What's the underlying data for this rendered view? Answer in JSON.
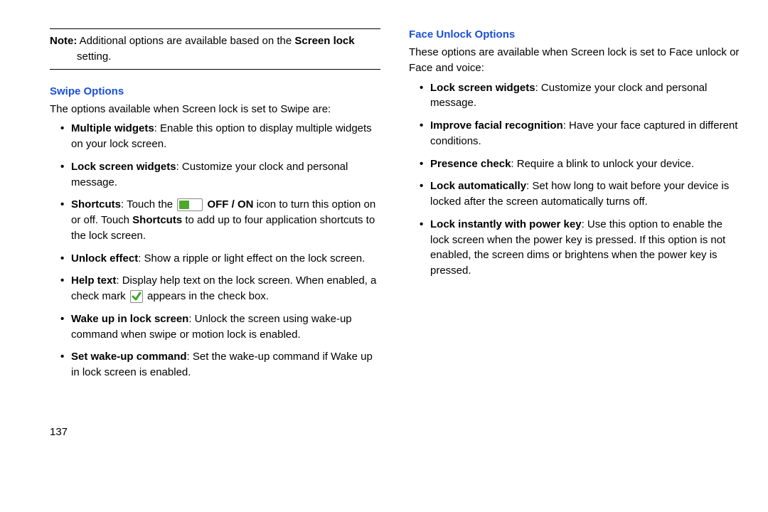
{
  "left": {
    "note_prefix": "Note:",
    "note_text1": " Additional options are available based on the ",
    "note_bold": "Screen lock",
    "note_text2": " setting.",
    "swipe_heading": "Swipe Options",
    "swipe_intro": "The options available when Screen lock is set to Swipe are:",
    "items": [
      {
        "bold": "Multiple widgets",
        "rest": ": Enable this option to display multiple widgets on your lock screen."
      },
      {
        "bold": "Lock screen widgets",
        "rest": ": Customize your clock and personal message."
      },
      {
        "bold": "Shortcuts",
        "pre": ": Touch the ",
        "icon": "toggle",
        "mid_bold": " OFF / ON",
        "mid": " icon to turn this option on or off. Touch ",
        "mid_bold2": "Shortcuts",
        "post": " to add up to four application shortcuts to the lock screen."
      },
      {
        "bold": "Unlock effect",
        "rest": ": Show a ripple or light effect on the lock screen."
      },
      {
        "bold": "Help text",
        "pre": ": Display help text on the lock screen. When enabled, a check mark ",
        "icon": "check",
        "post": " appears in the check box."
      },
      {
        "bold": "Wake up in lock screen",
        "rest": ": Unlock the screen using wake-up command when swipe or motion lock is enabled."
      },
      {
        "bold": "Set wake-up command",
        "rest": ": Set the wake-up command if Wake up in lock screen is enabled."
      }
    ],
    "page_number": "137"
  },
  "right": {
    "face_heading": "Face Unlock Options",
    "face_intro": "These options are available when Screen lock is set to Face unlock or Face and voice:",
    "items": [
      {
        "bold": "Lock screen widgets",
        "rest": ": Customize your clock and personal message."
      },
      {
        "bold": "Improve facial recognition",
        "rest": ": Have your face captured in different conditions."
      },
      {
        "bold": "Presence check",
        "rest": ": Require a blink to unlock your device."
      },
      {
        "bold": "Lock automatically",
        "rest": ": Set how long to wait before your device is locked after the screen automatically turns off."
      },
      {
        "bold": "Lock instantly with power key",
        "rest": ": Use this option to enable the lock screen when the power key is pressed. If this option is not enabled, the screen dims or brightens when the power key is pressed."
      }
    ]
  }
}
